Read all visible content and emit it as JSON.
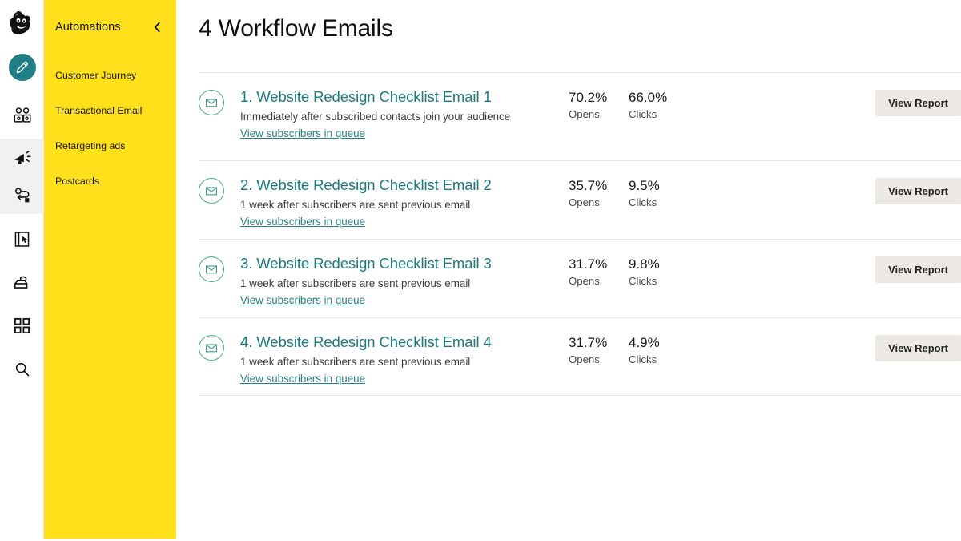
{
  "brand": {
    "logo_icon": "mailchimp-freddie-logo",
    "yellow": "#ffe01b",
    "teal": "#1a7b7f",
    "link_teal": "#2c8186",
    "envelope_green": "#4cab8e",
    "compose_teal": "#1f7f85",
    "button_bg": "#ece9e4"
  },
  "rail": {
    "items": [
      {
        "icon": "pencil-compose-icon",
        "name": "compose"
      },
      {
        "icon": "audience-people-icon",
        "name": "audience"
      },
      {
        "icon": "megaphone-campaigns-icon",
        "name": "campaigns"
      },
      {
        "icon": "automations-journey-icon",
        "name": "automations"
      },
      {
        "icon": "landing-page-icon",
        "name": "landing-pages"
      },
      {
        "icon": "website-store-icon",
        "name": "website"
      },
      {
        "icon": "grid-apps-icon",
        "name": "content-studio"
      },
      {
        "icon": "search-icon",
        "name": "search"
      }
    ]
  },
  "sidebar": {
    "title": "Automations",
    "collapse_icon": "chevron-left-icon",
    "items": [
      {
        "label": "Customer Journey"
      },
      {
        "label": "Transactional Email"
      },
      {
        "label": "Retargeting ads"
      },
      {
        "label": "Postcards"
      }
    ]
  },
  "main": {
    "page_title": "4 Workflow Emails",
    "stat_labels": {
      "opens": "Opens",
      "clicks": "Clicks"
    },
    "queue_link": "View subscribers in queue",
    "view_report_label": "View Report",
    "envelope_icon": "envelope-icon",
    "emails": [
      {
        "title": "1. Website Redesign Checklist Email 1",
        "description": "Immediately after subscribed contacts join your audience",
        "link": "View subscribers in queue",
        "opens": "70.2%",
        "opens_label": "Opens",
        "clicks": "66.0%",
        "clicks_label": "Clicks",
        "action": "View Report"
      },
      {
        "title": "2. Website Redesign Checklist Email 2",
        "description": "1 week after subscribers are sent previous email",
        "link": "View subscribers in queue",
        "opens": "35.7%",
        "opens_label": "Opens",
        "clicks": "9.5%",
        "clicks_label": "Clicks",
        "action": "View Report"
      },
      {
        "title": "3. Website Redesign Checklist Email 3",
        "description": "1 week after subscribers are sent previous email",
        "link": "View subscribers in queue",
        "opens": "31.7%",
        "opens_label": "Opens",
        "clicks": "9.8%",
        "clicks_label": "Clicks",
        "action": "View Report"
      },
      {
        "title": "4. Website Redesign Checklist Email 4",
        "description": "1 week after subscribers are sent previous email",
        "link": "View subscribers in queue",
        "opens": "31.7%",
        "opens_label": "Opens",
        "clicks": "4.9%",
        "clicks_label": "Clicks",
        "action": "View Report"
      }
    ]
  }
}
